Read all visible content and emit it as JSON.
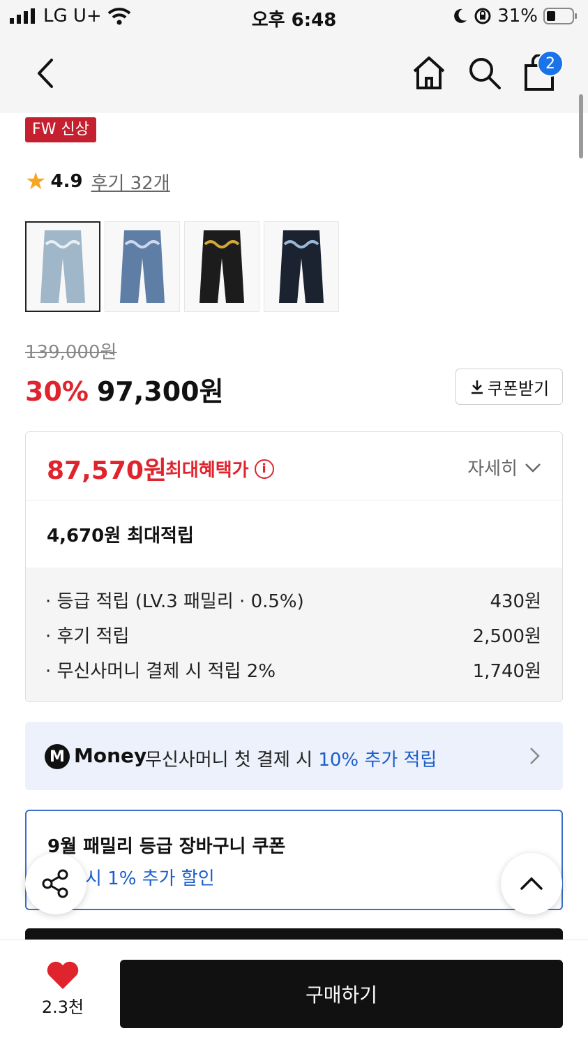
{
  "status_bar": {
    "carrier": "LG U+",
    "time": "오후 6:48",
    "battery": "31%"
  },
  "header": {
    "cart_count": "2"
  },
  "product": {
    "badge": "FW 신상",
    "rating": "4.9",
    "review_link": "후기 32개",
    "thumbnail_colors": [
      "#9fb7c9",
      "#5f7ea6",
      "#1c1c1c",
      "#1b2230"
    ],
    "thumbnail_print_colors": [
      "#e9eef2",
      "#cdd7ee",
      "#d4a63a",
      "#9ab8d6"
    ]
  },
  "price": {
    "original": "139,000원",
    "discount": "30%",
    "sale": "97,300원",
    "coupon_button": "쿠폰받기"
  },
  "benefits": {
    "max_benefit_price": "87,570원",
    "max_benefit_label": "최대혜택가",
    "detail_toggle": "자세히",
    "max_points": "4,670원 최대적립",
    "items": [
      {
        "label": "· 등급 적립 (LV.3 패밀리 · 0.5%)",
        "value": "430원"
      },
      {
        "label": "· 후기 적립",
        "value": "2,500원"
      },
      {
        "label": "· 무신사머니 결제 시 적립 2%",
        "value": "1,740원"
      }
    ]
  },
  "money_banner": {
    "logo_letter": "M",
    "name": "Money",
    "text": "무신사머니 첫 결제 시 ",
    "highlight": "10% 추가 적립"
  },
  "coupon_card": {
    "title": "9월 패밀리 등급 장바구니 쿠폰",
    "subtitle": "시 1% 추가 할인"
  },
  "bottom_bar": {
    "like_count": "2.3천",
    "buy_label": "구매하기"
  },
  "colors": {
    "accent_red": "#e0242d",
    "link_blue": "#1a5ecb",
    "badge_red": "#c42030"
  }
}
